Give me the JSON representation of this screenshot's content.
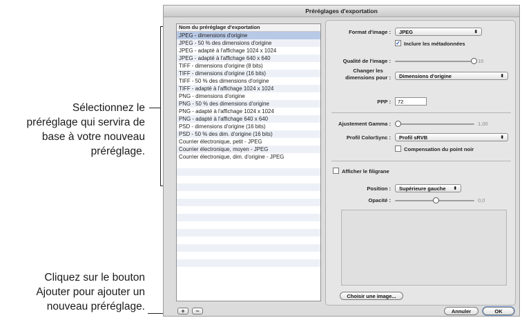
{
  "callouts": {
    "select_preset": [
      "Sélectionnez le",
      "préréglage qui servira de",
      "base à votre nouveau",
      "préréglage."
    ],
    "add_button": [
      "Cliquez sur le bouton",
      "Ajouter pour ajouter un",
      "nouveau préréglage."
    ]
  },
  "window": {
    "title": "Préréglages d'exportation"
  },
  "preset_list": {
    "header": "Nom du préréglage d'exportation",
    "selected_index": 0,
    "items": [
      "JPEG - dimensions d'origine",
      "JPEG - 50 % des dimensions d'origine",
      "JPEG - adapté à l'affichage 1024 x 1024",
      "JPEG - adapté à l'affichage 640 x 640",
      "TIFF - dimensions d'origine (8 bits)",
      "TIFF - dimensions d'origine (16 bits)",
      "TIFF - 50 % des dimensions d'origine",
      "TIFF - adapté à l'affichage 1024 x 1024",
      "PNG - dimensions d'origine",
      "PNG - 50 % des dimensions d'origine",
      "PNG - adapté à l'affichage 1024 x 1024",
      "PNG - adapté à l'affichage 640 x 640",
      "PSD - dimensions d'origine (16 bits)",
      "PSD - 50 % des dim. d'origine (16 bits)",
      "Courrier électronique, petit - JPEG",
      "Courrier électronique, moyen - JPEG",
      "Courrier électronique, dim. d'origine - JPEG"
    ]
  },
  "settings": {
    "format_label": "Format d'image :",
    "format_value": "JPEG",
    "include_metadata_label": "Inclure les métadonnées",
    "include_metadata_checked": true,
    "quality_label": "Qualité de l'image :",
    "quality_value": "10",
    "quality_fraction": 1.0,
    "resize_label_1": "Changer les",
    "resize_label_2": "dimensions pour :",
    "resize_value": "Dimensions d'origine",
    "ppp_label": "PPP :",
    "ppp_value": "72",
    "gamma_label": "Ajustement Gamma :",
    "gamma_value": "1,00",
    "gamma_fraction": 0.0,
    "colorsync_label": "Profil ColorSync :",
    "colorsync_value": "Profil sRVB",
    "black_point_label": "Compensation du point noir",
    "black_point_checked": false,
    "watermark_label": "Afficher le filigrane",
    "watermark_checked": false,
    "position_label": "Position :",
    "position_value": "Supérieure gauche",
    "opacity_label": "Opacité :",
    "opacity_value": "0,0",
    "opacity_fraction": 0.5,
    "choose_image_label": "Choisir une image..."
  },
  "buttons": {
    "add": "+",
    "remove": "−",
    "cancel": "Annuler",
    "ok": "OK"
  },
  "icons": {
    "checkmark": "check-icon",
    "popup_arrow": "popup-arrows-icon"
  }
}
